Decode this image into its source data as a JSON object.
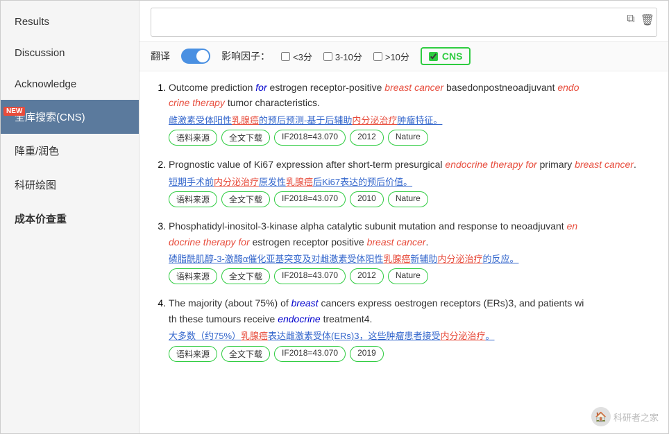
{
  "sidebar": {
    "items": [
      {
        "id": "results",
        "label": "Results",
        "active": false,
        "bold": false,
        "new": false
      },
      {
        "id": "discussion",
        "label": "Discussion",
        "active": false,
        "bold": false,
        "new": false
      },
      {
        "id": "acknowledge",
        "label": "Acknowledge",
        "active": false,
        "bold": false,
        "new": false
      },
      {
        "id": "fullsearch-cns",
        "label": "全库搜索(CNS)",
        "active": true,
        "bold": false,
        "new": true
      },
      {
        "id": "decline-run",
        "label": "降重/润色",
        "active": false,
        "bold": false,
        "new": false
      },
      {
        "id": "research-chart",
        "label": "科研绘图",
        "active": false,
        "bold": false,
        "new": false
      },
      {
        "id": "cost-recheck",
        "label": "成本价查重",
        "active": false,
        "bold": true,
        "new": false
      }
    ]
  },
  "search": {
    "placeholder": "",
    "value": ""
  },
  "filters": {
    "translate_label": "翻译",
    "influence_label": "影响因子：",
    "lt3_label": "<3分",
    "mid_label": "3-10分",
    "gt10_label": ">10分",
    "cns_label": "CNS",
    "lt3_checked": false,
    "mid_checked": false,
    "gt10_checked": false,
    "cns_checked": true,
    "translate_on": true
  },
  "results": [
    {
      "number": 1,
      "title_parts": [
        {
          "text": "Outcome prediction ",
          "style": "normal"
        },
        {
          "text": "for",
          "style": "italic-blue"
        },
        {
          "text": " estrogen receptor-positive ",
          "style": "normal"
        },
        {
          "text": "breast cancer",
          "style": "italic-red"
        },
        {
          "text": " basedonpostneoadjuvant ",
          "style": "normal"
        },
        {
          "text": "endo",
          "style": "italic-red"
        },
        {
          "text": "\ncrine therapy",
          "style": "italic-red"
        },
        {
          "text": " tumor characteristics.",
          "style": "normal"
        }
      ],
      "translation": "雌激素受体阳性乳腺癌的预后预测-基于后辅助内分泌治疗肿瘤特征。",
      "tags": [
        "语料来源",
        "全文下载",
        "IF2018=43.070",
        "2012",
        "Nature"
      ]
    },
    {
      "number": 2,
      "title_parts": [
        {
          "text": "Prognostic value of Ki67 expression after short-term presurgical ",
          "style": "normal"
        },
        {
          "text": "endocrine therapy for",
          "style": "italic-red"
        },
        {
          "text": " primary\n",
          "style": "normal"
        },
        {
          "text": "breast cancer",
          "style": "italic-red"
        },
        {
          "text": ".",
          "style": "normal"
        }
      ],
      "translation": "短期手术前内分泌治疗原发性乳腺癌后Ki67表达的预后价值。",
      "tags": [
        "语料来源",
        "全文下载",
        "IF2018=43.070",
        "2010",
        "Nature"
      ]
    },
    {
      "number": 3,
      "title_parts": [
        {
          "text": "Phosphatidyl-inositol-3-kinase alpha catalytic subunit mutation and response to neoadjuvant ",
          "style": "normal"
        },
        {
          "text": "en",
          "style": "italic-red"
        },
        {
          "text": "\ndocrine therapy for",
          "style": "italic-red"
        },
        {
          "text": " estrogen receptor positive ",
          "style": "normal"
        },
        {
          "text": "breast cancer",
          "style": "italic-red"
        },
        {
          "text": ".",
          "style": "normal"
        }
      ],
      "translation": "磷脂酰肌醇-3-激酶α催化亚基突变及对雌激素受体阳性乳腺癌新辅助内分泌治疗的反应。",
      "tags": [
        "语料来源",
        "全文下载",
        "IF2018=43.070",
        "2012",
        "Nature"
      ]
    },
    {
      "number": 4,
      "title_parts": [
        {
          "text": "The majority (about 75%) of ",
          "style": "normal"
        },
        {
          "text": "breast",
          "style": "italic-blue"
        },
        {
          "text": " cancers express oestrogen receptors (ERs)3, and patients wi\nth these tumours receive ",
          "style": "normal"
        },
        {
          "text": "endocrine",
          "style": "italic-blue"
        },
        {
          "text": " treatment4.",
          "style": "normal"
        }
      ],
      "translation": "大多数（约75%）乳腺癌表达雌激素受体(ERs)3，这些肿瘤患者接受内分泌治疗。",
      "tags": [
        "语料来源",
        "全文下载",
        "IF2018=43.070",
        "2019"
      ]
    }
  ],
  "watermark": {
    "text": "科研者之家",
    "icon": "🏠"
  }
}
